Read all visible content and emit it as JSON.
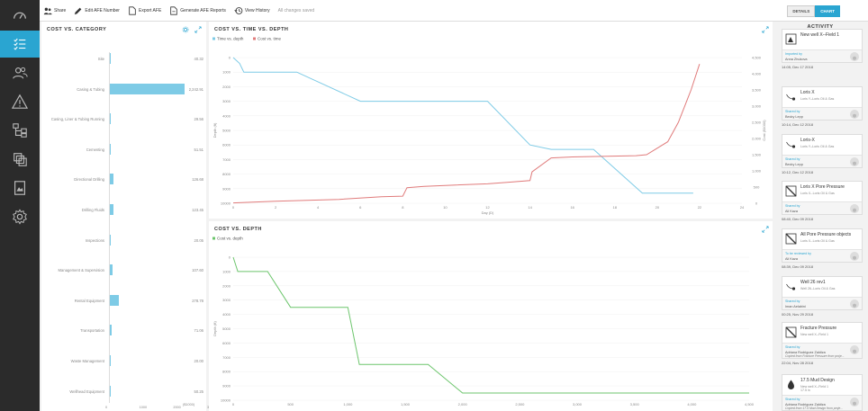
{
  "toolbar": {
    "share_label": "Share",
    "edit_label": "Edit AFE Number",
    "export_label": "Export AFE",
    "generate_label": "Generate AFE Reports",
    "history_label": "View History",
    "saved_note": "All changes saved",
    "details_label": "DETAILS",
    "chart_label": "CHART"
  },
  "nav": {
    "items": [
      "gauge-icon",
      "checklist-icon",
      "users-icon",
      "warning-icon",
      "hierarchy-icon",
      "layers-icon",
      "document-icon",
      "settings-icon"
    ],
    "active_index": 1
  },
  "colors": {
    "accent": "#2aa5d1",
    "time_series": "#7ecbe6",
    "cost_series": "#e07b7b",
    "depth_series": "#6cc56c"
  },
  "cost_category": {
    "title": "COST VS. CATEGORY",
    "chart_data": {
      "type": "bar",
      "orientation": "horizontal",
      "categories": [
        "Site",
        "Casing & Tubing",
        "Casing, Liner & Tubing Running",
        "Cementing",
        "Directional Drilling",
        "Drilling Fluids",
        "Inspections",
        "Management & Supervision",
        "Rental Equipment",
        "Transportation",
        "Waste Management",
        "Wellhead Equipment"
      ],
      "values": [
        40.32,
        2242.91,
        29.56,
        51.51,
        126.68,
        123.45,
        20.05,
        107.6,
        278.78,
        71.06,
        20.0,
        50.25
      ],
      "value_labels": [
        "40.32",
        "2,242.91",
        "29.56",
        "51.51",
        "126.68",
        "123.45",
        "20.05",
        "107.60",
        "278.78",
        "71.06",
        "20.00",
        "50.25"
      ],
      "xlim": [
        0,
        3000
      ],
      "x_ticks": [
        "0",
        "1000",
        "2000",
        "3000"
      ],
      "xlabel": "($1000)"
    }
  },
  "cost_time_depth": {
    "title": "COST VS. TIME VS. DEPTH",
    "chart_data": {
      "type": "line",
      "series": [
        {
          "name": "Time vs. depth",
          "axis": "left",
          "x": [
            0,
            0.3,
            0.5,
            2,
            3,
            6,
            8,
            12,
            14,
            15,
            17,
            19.3,
            21.7
          ],
          "y": [
            0,
            400,
            1000,
            1000,
            1000,
            3000,
            3000,
            3000,
            6000,
            6300,
            6300,
            9300,
            9300
          ]
        },
        {
          "name": "Cost vs. time",
          "axis": "right",
          "x": [
            0,
            2,
            5,
            7,
            8,
            8.2,
            9,
            10,
            12,
            13,
            14,
            14.1,
            15,
            16,
            19,
            19.5,
            20.5,
            21,
            21.6,
            22
          ],
          "y": [
            10,
            60,
            120,
            200,
            220,
            480,
            520,
            550,
            600,
            650,
            700,
            970,
            1400,
            1430,
            1470,
            1500,
            1900,
            2500,
            3500,
            4300
          ]
        }
      ],
      "xlabel": "Day (D)",
      "x_ticks": [
        0,
        2,
        4,
        6,
        8,
        10,
        12,
        14,
        16,
        18,
        20,
        22,
        24
      ],
      "xlim": [
        0,
        24
      ],
      "y_left_label": "Depth (ft)",
      "y_left_ticks": [
        0,
        1000,
        2000,
        3000,
        4000,
        5000,
        6000,
        7000,
        8000,
        9000,
        10000
      ],
      "y_left_ylim": [
        0,
        10000
      ],
      "y_right_label": "Cost ($1000)",
      "y_right_ticks": [
        "0",
        "500",
        "1,000",
        "1,500",
        "2,000",
        "2,500",
        "3,000",
        "3,500",
        "4,000",
        "4,500"
      ],
      "y_right_ylim": [
        0,
        4500
      ]
    }
  },
  "cost_depth": {
    "title": "COST VS. DEPTH",
    "chart_data": {
      "type": "line",
      "series": [
        {
          "name": "Cost vs. depth",
          "x": [
            0,
            40,
            300,
            500,
            750,
            1000,
            1100,
            1300,
            1400,
            1700,
            2000,
            2300,
            2600,
            3000,
            3500,
            4000,
            4500
          ],
          "y": [
            0,
            1000,
            1000,
            3500,
            3500,
            3500,
            7500,
            7500,
            7500,
            7500,
            9500,
            9500,
            9500,
            9500,
            9500,
            9500,
            9500
          ]
        }
      ],
      "x_ticks": [
        "0",
        "500",
        "1,000",
        "1,500",
        "2,000",
        "2,500",
        "3,000",
        "3,500",
        "4,000",
        "4,500"
      ],
      "xlim": [
        0,
        4500
      ],
      "ylabel": "Depth (ft)",
      "y_ticks": [
        0,
        1000,
        2000,
        3000,
        4000,
        5000,
        6000,
        7000,
        8000,
        9000,
        10000
      ],
      "ylim": [
        0,
        10000
      ]
    }
  },
  "activity": {
    "title": "ACTIVITY",
    "items": [
      {
        "name": "New well X--Field 1",
        "sub": "",
        "role": "Imported by",
        "user": "Anna Zhukova",
        "extra": "",
        "time": "14:05, Dec 17 2018",
        "icon": "well-file-icon"
      },
      {
        "name": "Loris X",
        "sub": "Loris Y--Loris Oil & Gas",
        "role": "Shared by",
        "user": "Becky Lepp",
        "extra": "",
        "time": "10:14, Dec 12 2018",
        "icon": "well-path-icon"
      },
      {
        "name": "Loris-X",
        "sub": "Loris Y--Loris Oil & Gas",
        "role": "Shared by",
        "user": "Becky Lepp",
        "extra": "",
        "time": "10:12, Dec 12 2018",
        "icon": "well-path-icon"
      },
      {
        "name": "Loris X Pore Pressure",
        "sub": "Loris X--Loris Oil & Gas",
        "role": "Shared by",
        "user": "Ali Kaza",
        "extra": "",
        "time": "08:40, Dec 09 2018",
        "icon": "pressure-chart-icon"
      },
      {
        "name": "All Pore Pressure objects",
        "sub": "Loris X--Loris Oil & Gas",
        "role": "To be reviewed by",
        "user": "Ali Kaza",
        "extra": "",
        "time": "08:39, Dec 09 2018",
        "icon": "pressure-chart-icon"
      },
      {
        "name": "Well 26 rev1",
        "sub": "Well 26--Loris Oil & Gas",
        "role": "Shared by",
        "user": "Iman Aelabini",
        "extra": "",
        "time": "00:25, Nov 29 2018",
        "icon": "well-path-icon"
      },
      {
        "name": "Fracture Pressure",
        "sub": "New well X--Field 1",
        "role": "Shared by",
        "user": "Adriana Rodriguez Zaldiza",
        "extra": "Copied from Fracture Pressure from proje...",
        "time": "22:04, Nov 28 2018",
        "icon": "pressure-chart-icon"
      },
      {
        "name": "17.5 Mud Design",
        "sub": "New well X--Field 1",
        "sub2": "17.5 in",
        "role": "Shared by",
        "user": "Adriana Rodriguez Zaldiza",
        "extra": "Copied from 17.5 Mud Design from proje...",
        "time": "",
        "icon": "drop-icon"
      }
    ]
  }
}
